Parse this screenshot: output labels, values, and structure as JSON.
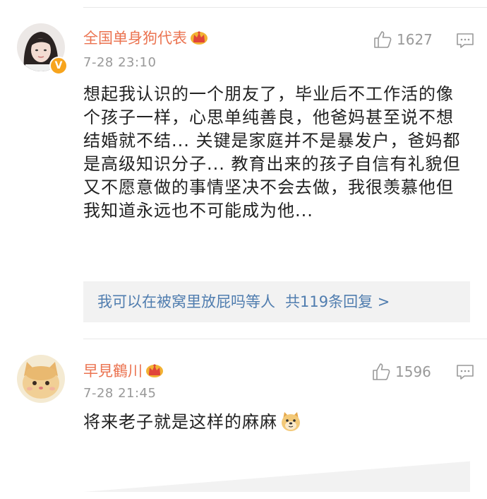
{
  "comments": [
    {
      "username": "全国单身狗代表",
      "timestamp": "7-28 23:10",
      "likes": "1627",
      "body": "想起我认识的一个朋友了，毕业后不工作活的像个孩子一样，心思单纯善良，他爸妈甚至说不想结婚就不结... 关键是家庭并不是暴发户，爸妈都是高级知识分子... 教育出来的孩子自信有礼貌但又不愿意做的事情坚决不会去做，我很羡慕他但我知道永远也不可能成为他...",
      "reply_preview": "我可以在被窝里放屁吗等人",
      "reply_count": "共119条回复 >"
    },
    {
      "username": "早見鶴川",
      "timestamp": "7-28 21:45",
      "likes": "1596",
      "body": "将来老子就是这样的麻麻"
    }
  ],
  "colors": {
    "username": "#eb7350",
    "link": "#507daf",
    "meta": "#999999",
    "reply_bg": "#f2f2f2"
  },
  "icons": [
    "crown-badge-icon",
    "verified-badge-icon",
    "like-thumb-icon",
    "comment-reply-icon",
    "doge-emoji-icon"
  ]
}
